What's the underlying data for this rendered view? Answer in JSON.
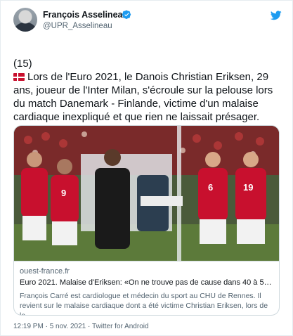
{
  "author": {
    "name": "François Asselineau",
    "handle": "@UPR_Asselineau"
  },
  "tweet": {
    "line1": "(15)",
    "line2": "Lors de l'Euro 2021, le Danois Christian Eriksen, 29 ans, joueur de l'Inter Milan, s'écroule sur la pelouse lors du match Danemark - Finlande, victime d'un malaise cardiaque inexpliqué et que rien ne laissait présager."
  },
  "card": {
    "domain": "ouest-france.fr",
    "title": "Euro 2021. Malaise d'Eriksen: «On ne trouve pas de cause dans 40 à 50 % des...",
    "description": "François Carré est cardiologue et médecin du sport au CHU de Rennes. Il revient sur le malaise cardiaque dont a été victime Christian Eriksen, lors de la ...",
    "players": {
      "left_number": "9",
      "right_number_a": "6",
      "right_number_b": "19"
    }
  },
  "footer": {
    "time": "12:19 PM",
    "separator": " · ",
    "date": "5 nov. 2021",
    "separator2": " · ",
    "source": "Twitter for Android"
  },
  "colors": {
    "verified": "#1d9bf0",
    "danish_red": "#c8102e"
  },
  "icons": [
    "verified-icon",
    "twitter-bird-icon",
    "denmark-flag-icon"
  ]
}
